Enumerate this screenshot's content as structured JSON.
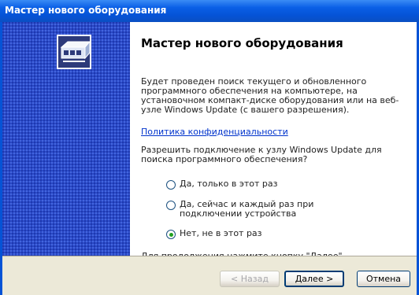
{
  "window": {
    "title": "Мастер нового оборудования"
  },
  "content": {
    "heading": "Мастер нового оборудования",
    "intro": "Будет проведен поиск текущего и обновленного программного обеспечения на компьютере, на установочном компакт-диске оборудования или на веб-узле Windows Update (с вашего разрешения).",
    "privacy_link": "Политика конфиденциальности",
    "question": "Разрешить подключение к узлу Windows Update для поиска программного обеспечения?",
    "options": [
      {
        "label": "Да, только в этот раз",
        "checked": false
      },
      {
        "label": "Да, сейчас и каждый раз при подключении устройства",
        "checked": false
      },
      {
        "label": "Нет, не в этот раз",
        "checked": true
      }
    ],
    "continue_hint": "Для продолжения нажмите кнопку \"Далее\"."
  },
  "buttons": {
    "back": "< Назад",
    "next": "Далее >",
    "cancel": "Отмена"
  },
  "colors": {
    "sidebar": "#2a4ac8",
    "titlebar": "#0553d6",
    "link": "#0033cc",
    "radio_selected": "#21a121"
  }
}
